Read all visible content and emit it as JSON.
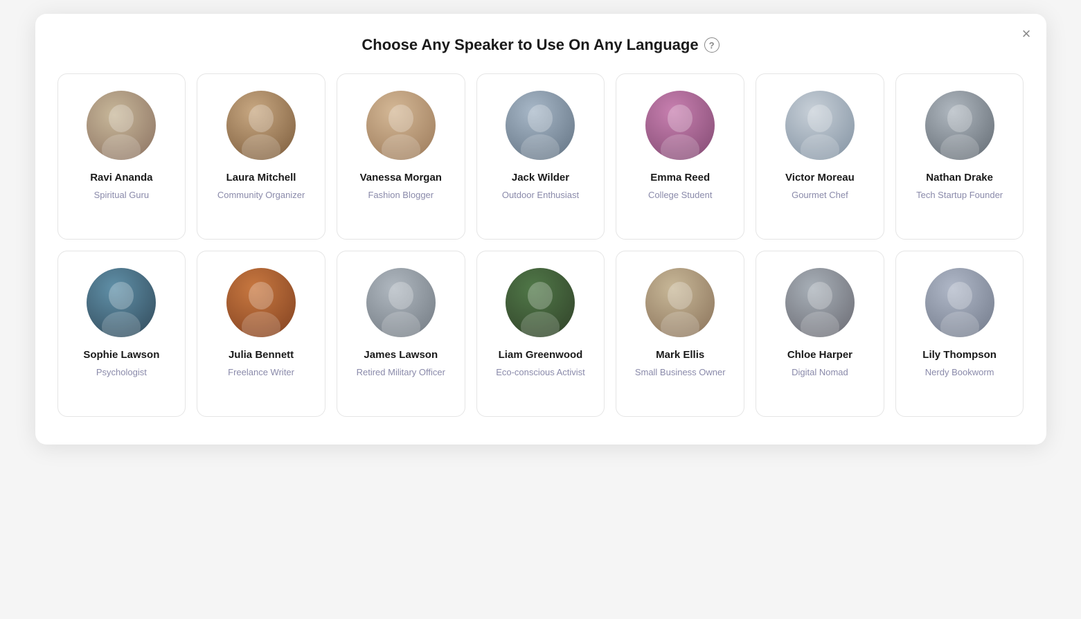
{
  "modal": {
    "title": "Choose Any Speaker to Use On Any Language",
    "close_label": "×",
    "help_label": "?"
  },
  "speakers": [
    {
      "id": "ravi-ananda",
      "name": "Ravi Ananda",
      "role": "Spiritual Guru",
      "avatar_class": "av-ravi",
      "avatar_glyph": "🧔"
    },
    {
      "id": "laura-mitchell",
      "name": "Laura Mitchell",
      "role": "Community Organizer",
      "avatar_class": "av-laura",
      "avatar_glyph": "👩"
    },
    {
      "id": "vanessa-morgan",
      "name": "Vanessa Morgan",
      "role": "Fashion Blogger",
      "avatar_class": "av-vanessa",
      "avatar_glyph": "👩"
    },
    {
      "id": "jack-wilder",
      "name": "Jack Wilder",
      "role": "Outdoor Enthusiast",
      "avatar_class": "av-jack",
      "avatar_glyph": "🧔"
    },
    {
      "id": "emma-reed",
      "name": "Emma Reed",
      "role": "College Student",
      "avatar_class": "av-emma",
      "avatar_glyph": "👩"
    },
    {
      "id": "victor-moreau",
      "name": "Victor Moreau",
      "role": "Gourmet Chef",
      "avatar_class": "av-victor",
      "avatar_glyph": "👨"
    },
    {
      "id": "nathan-drake",
      "name": "Nathan Drake",
      "role": "Tech Startup Founder",
      "avatar_class": "av-nathan",
      "avatar_glyph": "🧔"
    },
    {
      "id": "sophie-lawson",
      "name": "Sophie Lawson",
      "role": "Psychologist",
      "avatar_class": "av-sophie",
      "avatar_glyph": "👩"
    },
    {
      "id": "julia-bennett",
      "name": "Julia Bennett",
      "role": "Freelance Writer",
      "avatar_class": "av-julia",
      "avatar_glyph": "👩"
    },
    {
      "id": "james-lawson",
      "name": "James Lawson",
      "role": "Retired Military Officer",
      "avatar_class": "av-james",
      "avatar_glyph": "👨"
    },
    {
      "id": "liam-greenwood",
      "name": "Liam Greenwood",
      "role": "Eco-conscious Activist",
      "avatar_class": "av-liam",
      "avatar_glyph": "🧔"
    },
    {
      "id": "mark-ellis",
      "name": "Mark Ellis",
      "role": "Small Business Owner",
      "avatar_class": "av-mark",
      "avatar_glyph": "👨"
    },
    {
      "id": "chloe-harper",
      "name": "Chloe Harper",
      "role": "Digital Nomad",
      "avatar_class": "av-chloe",
      "avatar_glyph": "👩"
    },
    {
      "id": "lily-thompson",
      "name": "Lily Thompson",
      "role": "Nerdy Bookworm",
      "avatar_class": "av-lily",
      "avatar_glyph": "👩"
    }
  ]
}
